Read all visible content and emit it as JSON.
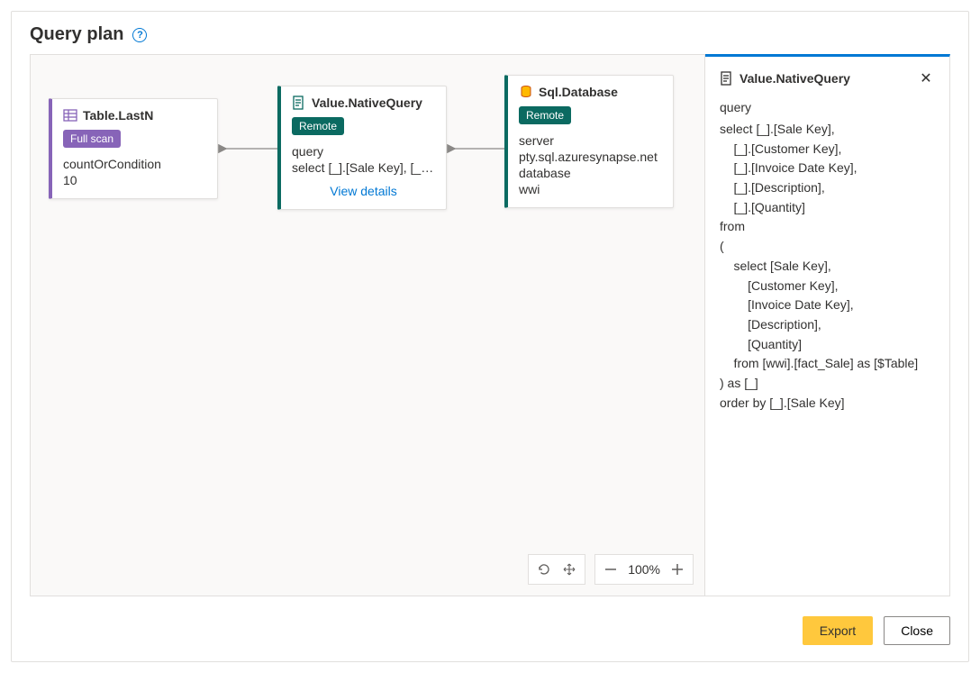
{
  "header": {
    "title": "Query plan"
  },
  "nodes": {
    "tableLastN": {
      "title": "Table.LastN",
      "badge": "Full scan",
      "param_label": "countOrCondition",
      "param_value": "10"
    },
    "nativeQuery": {
      "title": "Value.NativeQuery",
      "badge": "Remote",
      "param_label": "query",
      "param_value": "select [_].[Sale Key], [_]....",
      "view_details": "View details"
    },
    "sqlDatabase": {
      "title": "Sql.Database",
      "badge": "Remote",
      "server_label": "server",
      "server_value": "pty.sql.azuresynapse.net",
      "database_label": "database",
      "database_value": "wwi"
    }
  },
  "detail": {
    "title": "Value.NativeQuery",
    "label": "query",
    "body": "select [_].[Sale Key],\n    [_].[Customer Key],\n    [_].[Invoice Date Key],\n    [_].[Description],\n    [_].[Quantity]\nfrom\n(\n    select [Sale Key],\n        [Customer Key],\n        [Invoice Date Key],\n        [Description],\n        [Quantity]\n    from [wwi].[fact_Sale] as [$Table]\n) as [_]\norder by [_].[Sale Key]"
  },
  "zoom": {
    "level": "100%"
  },
  "footer": {
    "export": "Export",
    "close": "Close"
  }
}
